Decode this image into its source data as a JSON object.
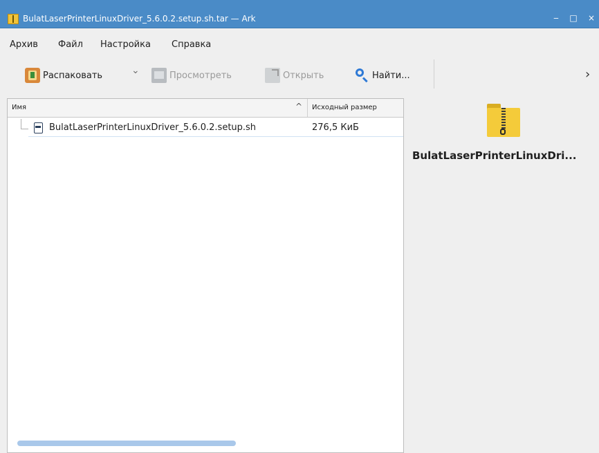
{
  "window": {
    "title": "BulatLaserPrinterLinuxDriver_5.6.0.2.setup.sh.tar — Ark",
    "minimize": "‒",
    "maximize": "□",
    "close": "×"
  },
  "menu": {
    "items": [
      "Архив",
      "Файл",
      "Настройка",
      "Справка"
    ]
  },
  "toolbar": {
    "extract_label": "Распаковать",
    "preview_label": "Просмотреть",
    "open_label": "Открыть",
    "find_label": "Найти...",
    "more": "›"
  },
  "filelist": {
    "columns": [
      "Имя",
      "Исходный размер"
    ],
    "sort_indicator": "^",
    "rows": [
      {
        "name": "BulatLaserPrinterLinuxDriver_5.6.0.2.setup.sh",
        "size": "276,5 КиБ"
      }
    ]
  },
  "info": {
    "archive_name": "BulatLaserPrinterLinuxDri..."
  },
  "colors": {
    "titlebar": "#4a8bc7",
    "selection_line": "#d0e2f3",
    "scrollbar": "#a9c8ea",
    "find_icon": "#2f7ad6",
    "archive_icon": "#f4cb3a"
  }
}
